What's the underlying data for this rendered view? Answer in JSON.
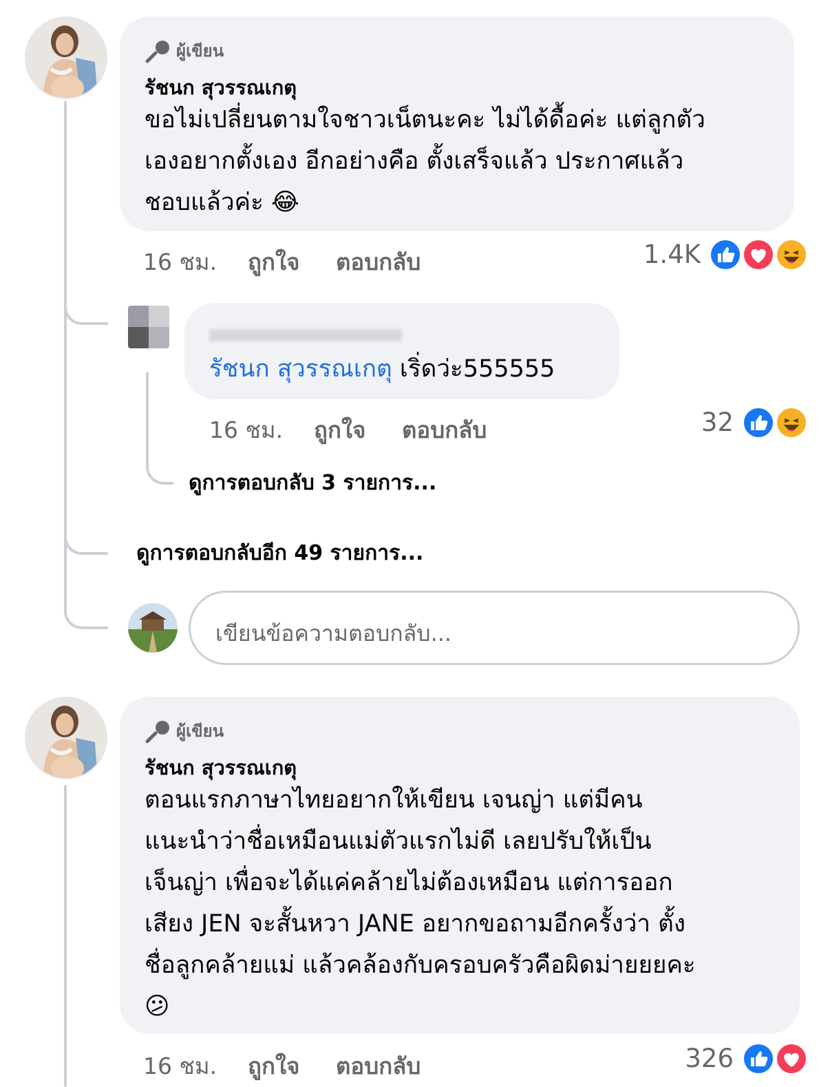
{
  "comment1": {
    "badge": "ผู้เขียน",
    "author": "รัชนก สุวรรณเกตุ",
    "text_lines": [
      "ขอไม่เปลี่ยนตามใจชาวเน็ตนะคะ ไม่ได้ดื้อค่ะ แต่ลูกตัว",
      "เองอยากตั้งเอง อีกอย่างคือ ตั้งเสร็จแล้ว ประกาศแล้ว",
      "ชอบแล้วค่ะ"
    ],
    "emoji": "😂",
    "time": "16 ชม.",
    "like_label": "ถูกใจ",
    "reply_label": "ตอบกลับ",
    "reaction_count": "1.4K",
    "reactions": [
      "like-icon",
      "love-icon",
      "haha-icon"
    ]
  },
  "reply1": {
    "mention": "รัชนก สุวรรณเกตุ",
    "text": " เริ่ดว่ะ555555",
    "time": "16 ชม.",
    "like_label": "ถูกใจ",
    "reply_label": "ตอบกลับ",
    "reaction_count": "32",
    "reactions": [
      "like-icon",
      "haha-icon"
    ],
    "view_replies": "ดูการตอบกลับ 3 รายการ..."
  },
  "view_more_replies": "ดูการตอบกลับอีก 49 รายการ...",
  "reply_input": {
    "placeholder": "เขียนข้อความตอบกลับ..."
  },
  "comment2": {
    "badge": "ผู้เขียน",
    "author": "รัชนก สุวรรณเกตุ",
    "text_lines": [
      "ตอนแรกภาษาไทยอยากให้เขียน เจนญ่า แต่มีคน",
      "แนะนำว่าชื่อเหมือนแม่ตัวแรกไม่ดี เลยปรับให้เป็น",
      "เจ็นญ่า เพื่อจะได้แค่คล้ายไม่ต้องเหมือน แต่การออก",
      "เสียง JEN จะสั้นหวา JANE อยากขอถามอีกครั้งว่า ตั้ง",
      "ชื่อลูกคล้ายแม่ แล้วคล้องกับครอบครัวคือผิดม่ายยยคะ"
    ],
    "emoji": "😕",
    "time": "16 ชม.",
    "like_label": "ถูกใจ",
    "reply_label": "ตอบกลับ",
    "reaction_count": "326",
    "reactions": [
      "like-icon",
      "love-icon"
    ]
  },
  "colors": {
    "bubble": "#f0f2f5",
    "meta_text": "#65676b",
    "mention": "#216fdb",
    "like": "#1877f2",
    "love": "#f33e58",
    "haha": "#f7b125"
  }
}
